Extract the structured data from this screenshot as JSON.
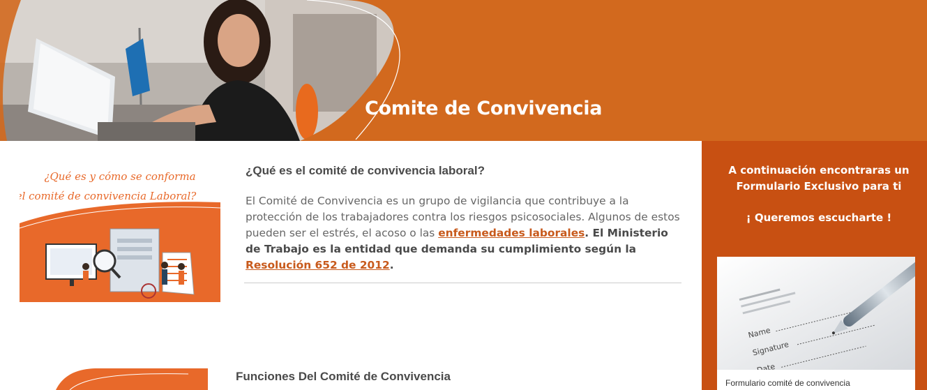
{
  "hero": {
    "title": "Comite de Convivencia",
    "background_color": "#d2691e"
  },
  "main": {
    "image1": {
      "alt_lines": [
        "¿Qué es y cómo se conforma",
        "el comité de convivencia Laboral?"
      ],
      "accent_color": "#e8692a"
    },
    "section1": {
      "heading": "¿Qué es el comité de convivencia laboral?",
      "paragraph_part1": "El Comité de Convivencia es un grupo de vigilancia que contribuye a la protección de los trabajadores contra los riesgos psicosociales. Algunos de estos pueden ser el estrés, el acoso o las ",
      "link1": "enfermedades laborales",
      "paragraph_part2": ". El Ministerio de Trabajo es la entidad que demanda su cumplimiento según la ",
      "link2": "Resolución 652 de 2012",
      "paragraph_part3": "."
    },
    "section2": {
      "heading": "Funciones Del Comité de Convivencia"
    }
  },
  "sidebar": {
    "background_color": "#c85012",
    "text1_line1": "A continuación encontraras un",
    "text1_line2": "Formulario Exclusivo para ti",
    "text2": "¡ Queremos escucharte !",
    "card": {
      "image_labels": [
        "Name",
        "Signature",
        "Date"
      ],
      "caption": "Formulario comité de convivencia"
    }
  }
}
